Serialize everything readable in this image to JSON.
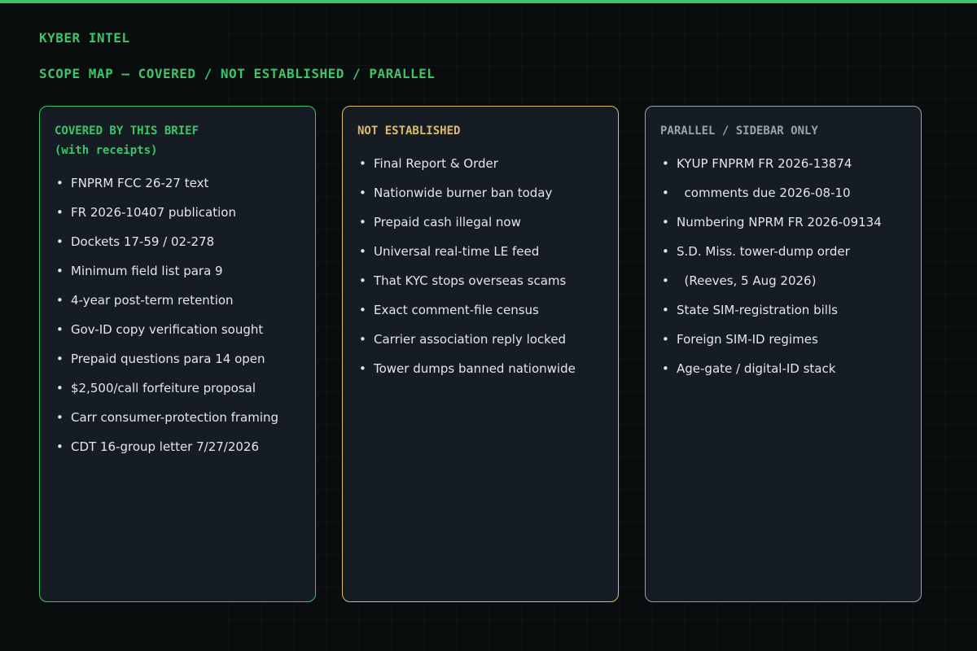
{
  "header": {
    "brand": "KYBER INTEL",
    "title": "SCOPE MAP — COVERED / NOT ESTABLISHED / PARALLEL"
  },
  "colors": {
    "accent_green": "#3cc468",
    "accent_amber": "#e0b96a",
    "accent_gray": "#9aa3ab",
    "panel_bg": "#161c23",
    "page_bg": "#0a0d0d"
  },
  "panels": {
    "covered": {
      "title_line1": "COVERED BY THIS BRIEF",
      "title_line2": "(with receipts)",
      "items": [
        "FNPRM FCC 26-27 text",
        "FR 2026-10407 publication",
        "Dockets 17-59 / 02-278",
        "Minimum field list para 9",
        "4-year post-term retention",
        "Gov-ID copy verification sought",
        "Prepaid questions para 14 open",
        "$2,500/call forfeiture proposal",
        "Carr consumer-protection framing",
        "CDT 16-group letter 7/27/2026"
      ]
    },
    "not_established": {
      "title": "NOT ESTABLISHED",
      "items": [
        "Final Report & Order",
        "Nationwide burner ban today",
        "Prepaid cash illegal now",
        "Universal real-time LE feed",
        "That KYC stops overseas scams",
        "Exact comment-file census",
        "Carrier association reply locked",
        "Tower dumps banned nationwide"
      ]
    },
    "parallel": {
      "title": "PARALLEL / SIDEBAR ONLY",
      "items": [
        "KYUP FNPRM FR 2026-13874",
        "  comments due 2026-08-10",
        "Numbering NPRM FR 2026-09134",
        "S.D. Miss. tower-dump order",
        "  (Reeves, 5 Aug 2026)",
        "State SIM-registration bills",
        "Foreign SIM-ID regimes",
        "Age-gate / digital-ID stack"
      ]
    }
  }
}
